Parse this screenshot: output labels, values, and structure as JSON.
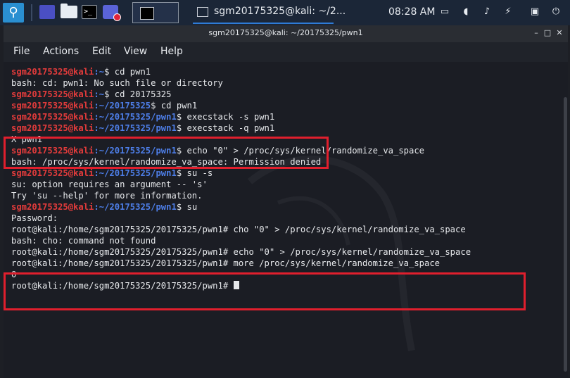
{
  "taskbar": {
    "kali_logo": "kali-dragon-icon",
    "task_title": "sgm20175325@kali: ~/2...",
    "clock": "08:28 AM",
    "tray_icons": [
      "display-icon",
      "bell-icon",
      "power-icon",
      "lock-icon",
      "power-button-icon"
    ]
  },
  "window": {
    "title": "sgm20175325@kali: ~/20175325/pwn1",
    "menu": [
      "File",
      "Actions",
      "Edit",
      "View",
      "Help"
    ],
    "buttons": {
      "minimize": "–",
      "maximize": "□",
      "close": "✕"
    }
  },
  "terminal": {
    "lines": [
      {
        "user": "sgm20175325@kali",
        "path": ":~",
        "sym": "$",
        "cmd": " cd pwn1"
      },
      {
        "text": "bash: cd: pwn1: No such file or directory"
      },
      {
        "user": "sgm20175325@kali",
        "path": ":~",
        "sym": "$",
        "cmd": " cd 20175325"
      },
      {
        "user": "sgm20175325@kali",
        "path": ":~/20175325",
        "sym": "$",
        "cmd": " cd pwn1"
      },
      {
        "user": "sgm20175325@kali",
        "path": ":~/20175325/pwn1",
        "sym": "$",
        "cmd": " execstack -s pwn1"
      },
      {
        "user": "sgm20175325@kali",
        "path": ":~/20175325/pwn1",
        "sym": "$",
        "cmd": " execstack -q pwn1"
      },
      {
        "text": "X pwn1"
      },
      {
        "user": "sgm20175325@kali",
        "path": ":~/20175325/pwn1",
        "sym": "$",
        "cmd": " echo \"0\" > /proc/sys/kernel/randomize_va_space"
      },
      {
        "text": "bash: /proc/sys/kernel/randomize_va_space: Permission denied"
      },
      {
        "user": "sgm20175325@kali",
        "path": ":~/20175325/pwn1",
        "sym": "$",
        "cmd": " su -s"
      },
      {
        "text": "su: option requires an argument -- 's'"
      },
      {
        "text": "Try 'su --help' for more information."
      },
      {
        "user": "sgm20175325@kali",
        "path": ":~/20175325/pwn1",
        "sym": "$",
        "cmd": " su"
      },
      {
        "text": "Password:"
      },
      {
        "text": "root@kali:/home/sgm20175325/20175325/pwn1# cho \"0\" > /proc/sys/kernel/randomize_va_space"
      },
      {
        "text": "bash: cho: command not found"
      },
      {
        "text": "root@kali:/home/sgm20175325/20175325/pwn1# echo \"0\" > /proc/sys/kernel/randomize_va_space"
      },
      {
        "text": "root@kali:/home/sgm20175325/20175325/pwn1# more /proc/sys/kernel/randomize_va_space"
      },
      {
        "text": "0"
      },
      {
        "text": "root@kali:/home/sgm20175325/20175325/pwn1# "
      }
    ]
  },
  "colors": {
    "highlight_box": "#e01f2d",
    "user": "#e23b3b",
    "path": "#4d7ee8"
  }
}
